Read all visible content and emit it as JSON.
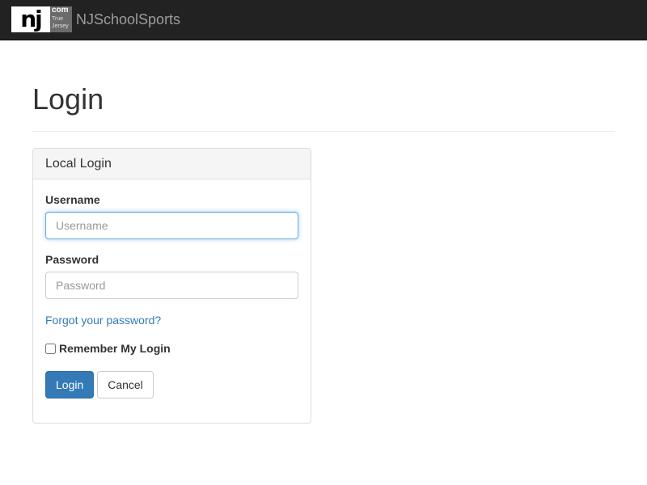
{
  "navbar": {
    "logo": {
      "main": "nj",
      "com": "com",
      "tagline_top": "True",
      "tagline_bottom": "Jersey"
    },
    "brand_name": "NJSchoolSports",
    "background_color": "#222222"
  },
  "page": {
    "title": "Login"
  },
  "login_panel": {
    "heading": "Local Login",
    "username": {
      "label": "Username",
      "placeholder": "Username",
      "value": ""
    },
    "password": {
      "label": "Password",
      "placeholder": "Password",
      "value": ""
    },
    "forgot_password_link": "Forgot your password?",
    "remember_label": "Remember My Login",
    "remember_checked": false,
    "login_button": "Login",
    "cancel_button": "Cancel"
  },
  "colors": {
    "primary": "#337ab7",
    "link": "#337ab7",
    "focus_border": "#66afe9"
  }
}
